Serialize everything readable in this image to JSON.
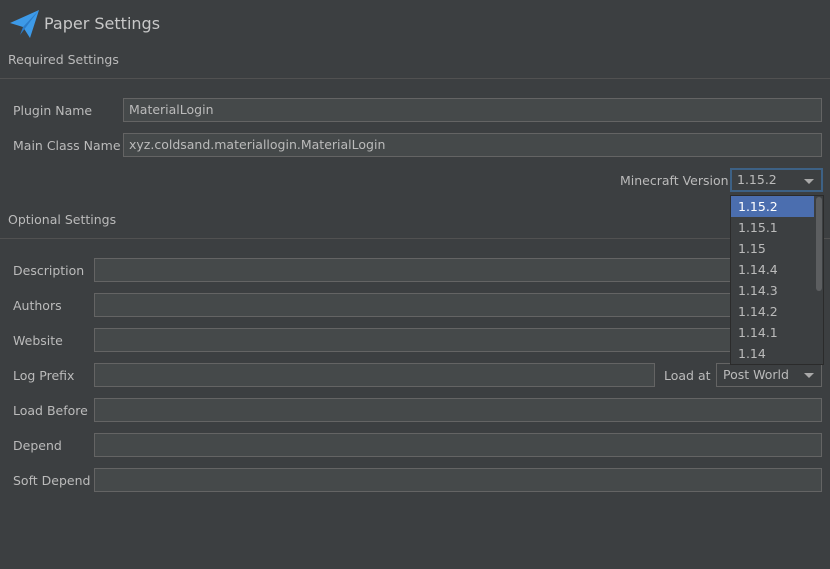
{
  "header": {
    "title": "Paper Settings",
    "icon": "paper-plane-icon"
  },
  "required": {
    "section_label": "Required Settings",
    "plugin_name_label": "Plugin Name",
    "plugin_name_value": "MaterialLogin",
    "main_class_label": "Main Class Name",
    "main_class_value": "xyz.coldsand.materiallogin.MaterialLogin",
    "mc_version_label": "Minecraft Version",
    "mc_version_value": "1.15.2",
    "mc_version_options": [
      "1.15.2",
      "1.15.1",
      "1.15",
      "1.14.4",
      "1.14.3",
      "1.14.2",
      "1.14.1",
      "1.14"
    ]
  },
  "optional": {
    "section_label": "Optional Settings",
    "description_label": "Description",
    "authors_label": "Authors",
    "website_label": "Website",
    "log_prefix_label": "Log Prefix",
    "load_at_label": "Load at",
    "load_at_value": "Post World",
    "load_before_label": "Load Before",
    "depend_label": "Depend",
    "soft_depend_label": "Soft Depend"
  },
  "colors": {
    "background": "#3c3f41",
    "field_bg": "#45494a",
    "selection": "#4b6eaf",
    "logo": "#3d9ae8",
    "focus": "#3d6185"
  }
}
